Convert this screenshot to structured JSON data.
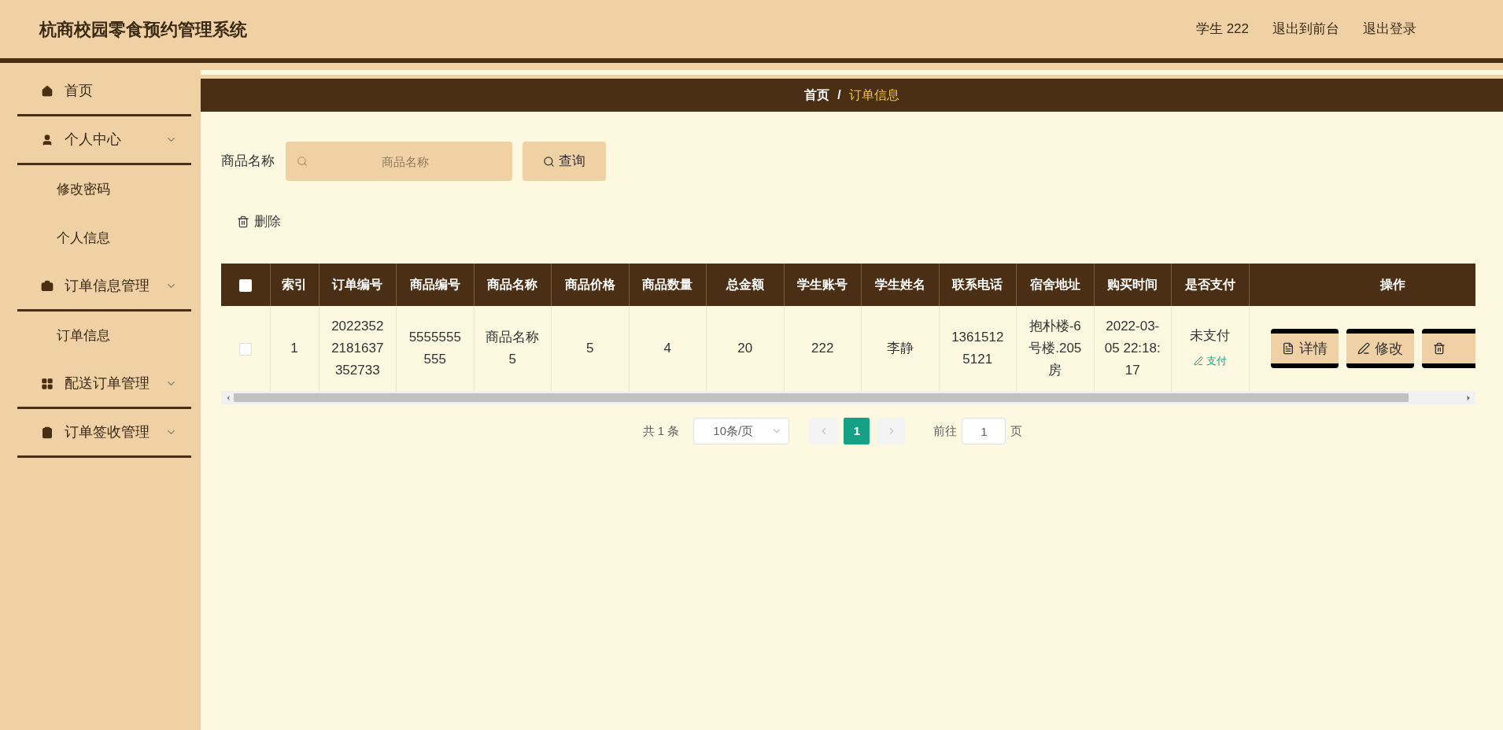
{
  "header": {
    "title": "杭商校园零食预约管理系统",
    "user": "学生 222",
    "links": [
      "退出到前台",
      "退出登录"
    ]
  },
  "sidebar": {
    "items": [
      {
        "label": "首页"
      },
      {
        "label": "个人中心",
        "children": [
          {
            "label": "修改密码"
          },
          {
            "label": "个人信息"
          }
        ]
      },
      {
        "label": "订单信息管理",
        "children": [
          {
            "label": "订单信息"
          }
        ]
      },
      {
        "label": "配送订单管理"
      },
      {
        "label": "订单签收管理"
      }
    ]
  },
  "breadcrumb": {
    "items": [
      "首页",
      "订单信息"
    ],
    "separator": "/"
  },
  "search": {
    "label": "商品名称",
    "placeholder": "商品名称",
    "button": "查询"
  },
  "delete_button": "删除",
  "table": {
    "header_checked": false,
    "columns": [
      "索引",
      "订单编号",
      "商品编号",
      "商品名称",
      "商品价格",
      "商品数量",
      "总金额",
      "学生账号",
      "学生姓名",
      "联系电话",
      "宿舍地址",
      "购买时间",
      "是否支付",
      "操作"
    ],
    "rows": [
      {
        "checked": false,
        "cells": [
          "1",
          "20223522181637352733",
          "5555555555",
          "商品名称5",
          "5",
          "4",
          "20",
          "222",
          "李静",
          "13615125121",
          "抱朴楼-6号楼.205房",
          "2022-03-05 22:18:17"
        ],
        "pay_status": "未支付",
        "pay_link": "支付",
        "actions": [
          "详情",
          "修改"
        ]
      }
    ]
  },
  "pagination": {
    "total": "共 1 条",
    "page_size": "10条/页",
    "pages": [
      {
        "label": "1",
        "selected": true
      }
    ],
    "goto_label": "前往",
    "goto_value": "1",
    "page_unit": "页"
  }
}
